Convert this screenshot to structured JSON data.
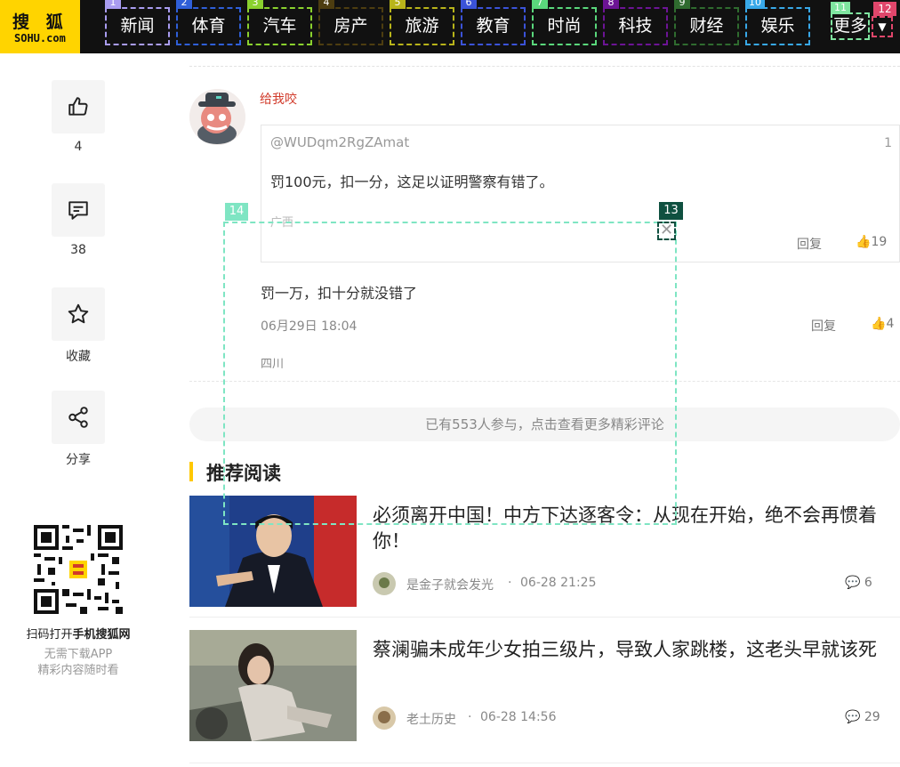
{
  "logo": {
    "line1": "搜 狐",
    "line2": "SOHU.com"
  },
  "nav": [
    {
      "label": "新闻",
      "badge": "1",
      "color": "#a99cf0"
    },
    {
      "label": "体育",
      "badge": "2",
      "color": "#2f5fd8"
    },
    {
      "label": "汽车",
      "badge": "3",
      "color": "#8ad12e"
    },
    {
      "label": "房产",
      "badge": "4",
      "color": "#4d3d10"
    },
    {
      "label": "旅游",
      "badge": "5",
      "color": "#b8b41a"
    },
    {
      "label": "教育",
      "badge": "6",
      "color": "#3b53d9"
    },
    {
      "label": "时尚",
      "badge": "7",
      "color": "#5ad87c"
    },
    {
      "label": "科技",
      "badge": "8",
      "color": "#6c1495"
    },
    {
      "label": "财经",
      "badge": "9",
      "color": "#2f6b2f"
    },
    {
      "label": "娱乐",
      "badge": "10",
      "color": "#38a8e8"
    },
    {
      "label": "更多",
      "badge": "11",
      "color": "#7fe5a0"
    }
  ],
  "more_dropdown": {
    "badge": "12",
    "icon": "caret-down-icon"
  },
  "sidebar": {
    "like_count": "4",
    "comment_count": "38",
    "favorite_label": "收藏",
    "share_label": "分享"
  },
  "qr": {
    "title_prefix": "扫码打开",
    "title_bold": "手机搜狐网",
    "line2": "无需下载APP",
    "line3": "精彩内容随时看"
  },
  "comment": {
    "username": "给我咬",
    "quote": {
      "user": "@WUDqm2RgZAmat",
      "floor": "1",
      "text": "罚100元，扣一分，这足以证明警察有错了。",
      "location": "广西",
      "reply_label": "回复",
      "likes": "19"
    },
    "text": "罚一万，扣十分就没错了",
    "time": "06月29日 18:04",
    "reply_label": "回复",
    "likes": "4",
    "location": "四川"
  },
  "more_comments": "已有553人参与，点击查看更多精彩评论",
  "section_title": "推荐阅读",
  "articles": [
    {
      "title": "必须离开中国！中方下达逐客令：从现在开始，绝不会再惯着你！",
      "author": "是金子就会发光",
      "time": "06-28 21:25",
      "comments": "6"
    },
    {
      "title": "蔡澜骗未成年少女拍三级片，导致人家跳楼，这老头早就该死",
      "author": "老土历史",
      "time": "06-28 14:56",
      "comments": "29"
    }
  ],
  "overlay": {
    "badge_left": "14",
    "badge_close": "13",
    "close_icon": "close-icon"
  }
}
